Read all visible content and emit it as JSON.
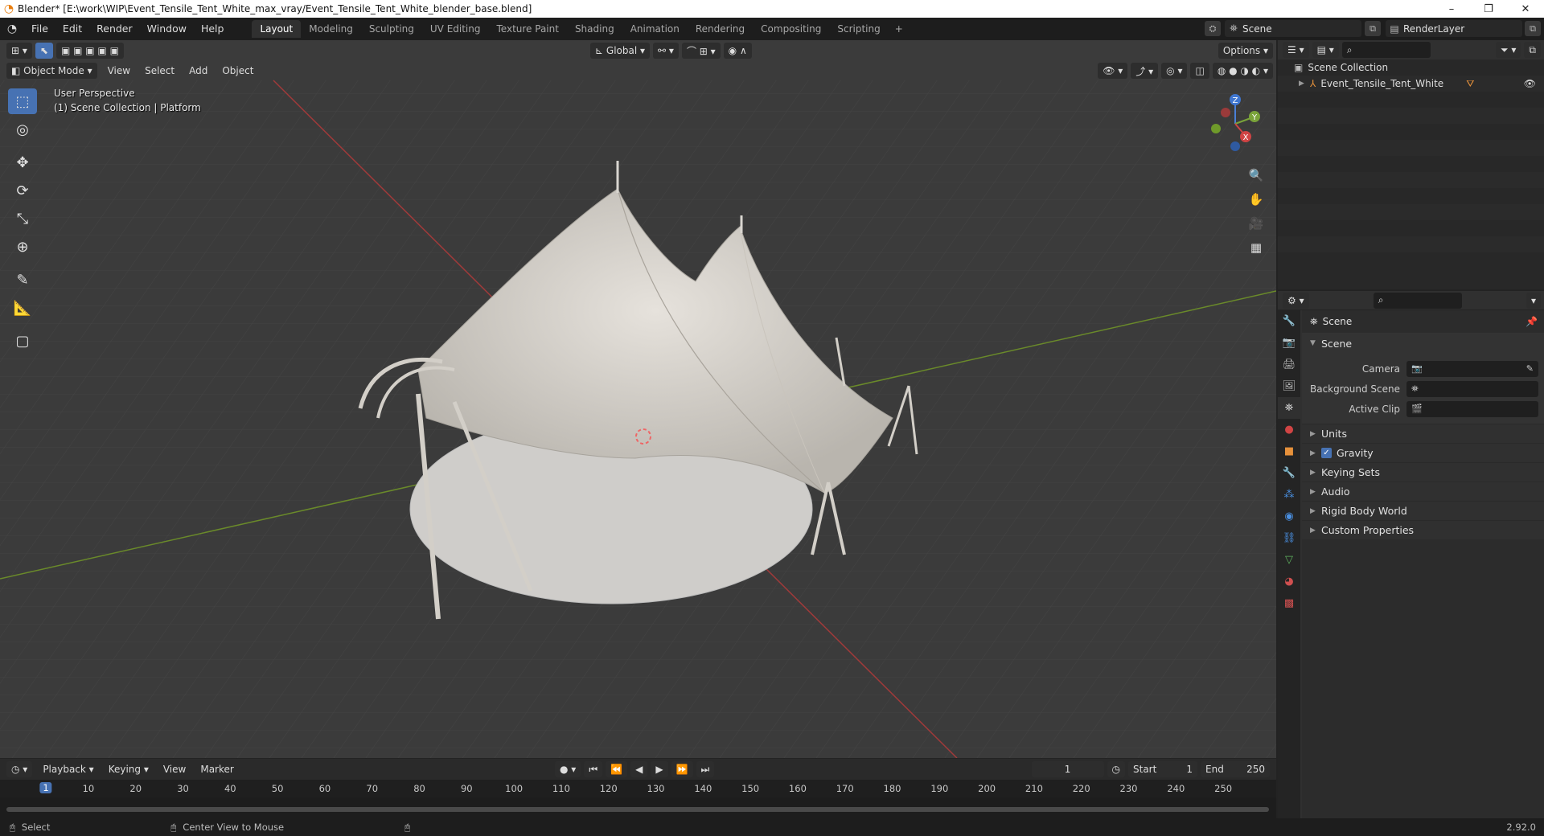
{
  "window": {
    "title": "Blender* [E:\\work\\WIP\\Event_Tensile_Tent_White_max_vray/Event_Tensile_Tent_White_blender_base.blend]",
    "minimize": "–",
    "maximize": "❐",
    "close": "✕"
  },
  "menubar": {
    "items": [
      "File",
      "Edit",
      "Render",
      "Window",
      "Help"
    ]
  },
  "workspaces": {
    "tabs": [
      "Layout",
      "Modeling",
      "Sculpting",
      "UV Editing",
      "Texture Paint",
      "Shading",
      "Animation",
      "Rendering",
      "Compositing",
      "Scripting"
    ],
    "active": "Layout",
    "add": "+"
  },
  "scene_selector": {
    "value": "Scene"
  },
  "view_layer": {
    "value": "RenderLayer"
  },
  "viewport": {
    "mode": "Object Mode",
    "menus": [
      "View",
      "Select",
      "Add",
      "Object"
    ],
    "orientation": "Global",
    "options": "Options",
    "info_line1": "User Perspective",
    "info_line2": "(1) Scene Collection | Platform",
    "axis_x": "X",
    "axis_y": "Y",
    "axis_z": "Z"
  },
  "outliner": {
    "root": "Scene Collection",
    "items": [
      {
        "label": "Event_Tensile_Tent_White"
      }
    ]
  },
  "properties": {
    "context": "Scene",
    "panel": "Scene",
    "fields": [
      {
        "label": "Camera"
      },
      {
        "label": "Background Scene"
      },
      {
        "label": "Active Clip"
      }
    ],
    "subpanels": [
      {
        "label": "Units",
        "checkbox": false
      },
      {
        "label": "Gravity",
        "checkbox": true
      },
      {
        "label": "Keying Sets",
        "checkbox": false
      },
      {
        "label": "Audio",
        "checkbox": false
      },
      {
        "label": "Rigid Body World",
        "checkbox": false
      },
      {
        "label": "Custom Properties",
        "checkbox": false
      }
    ]
  },
  "timeline": {
    "menus": [
      "Playback",
      "Keying",
      "View",
      "Marker"
    ],
    "current_frame": "1",
    "start_label": "Start",
    "start": "1",
    "end_label": "End",
    "end": "250",
    "ruler": [
      "1",
      "10",
      "20",
      "30",
      "40",
      "50",
      "60",
      "70",
      "80",
      "90",
      "100",
      "110",
      "120",
      "130",
      "140",
      "150",
      "160",
      "170",
      "180",
      "190",
      "200",
      "210",
      "220",
      "230",
      "240",
      "250"
    ]
  },
  "statusbar": {
    "left": "Select",
    "middle": "Center View to Mouse",
    "version": "2.92.0"
  }
}
